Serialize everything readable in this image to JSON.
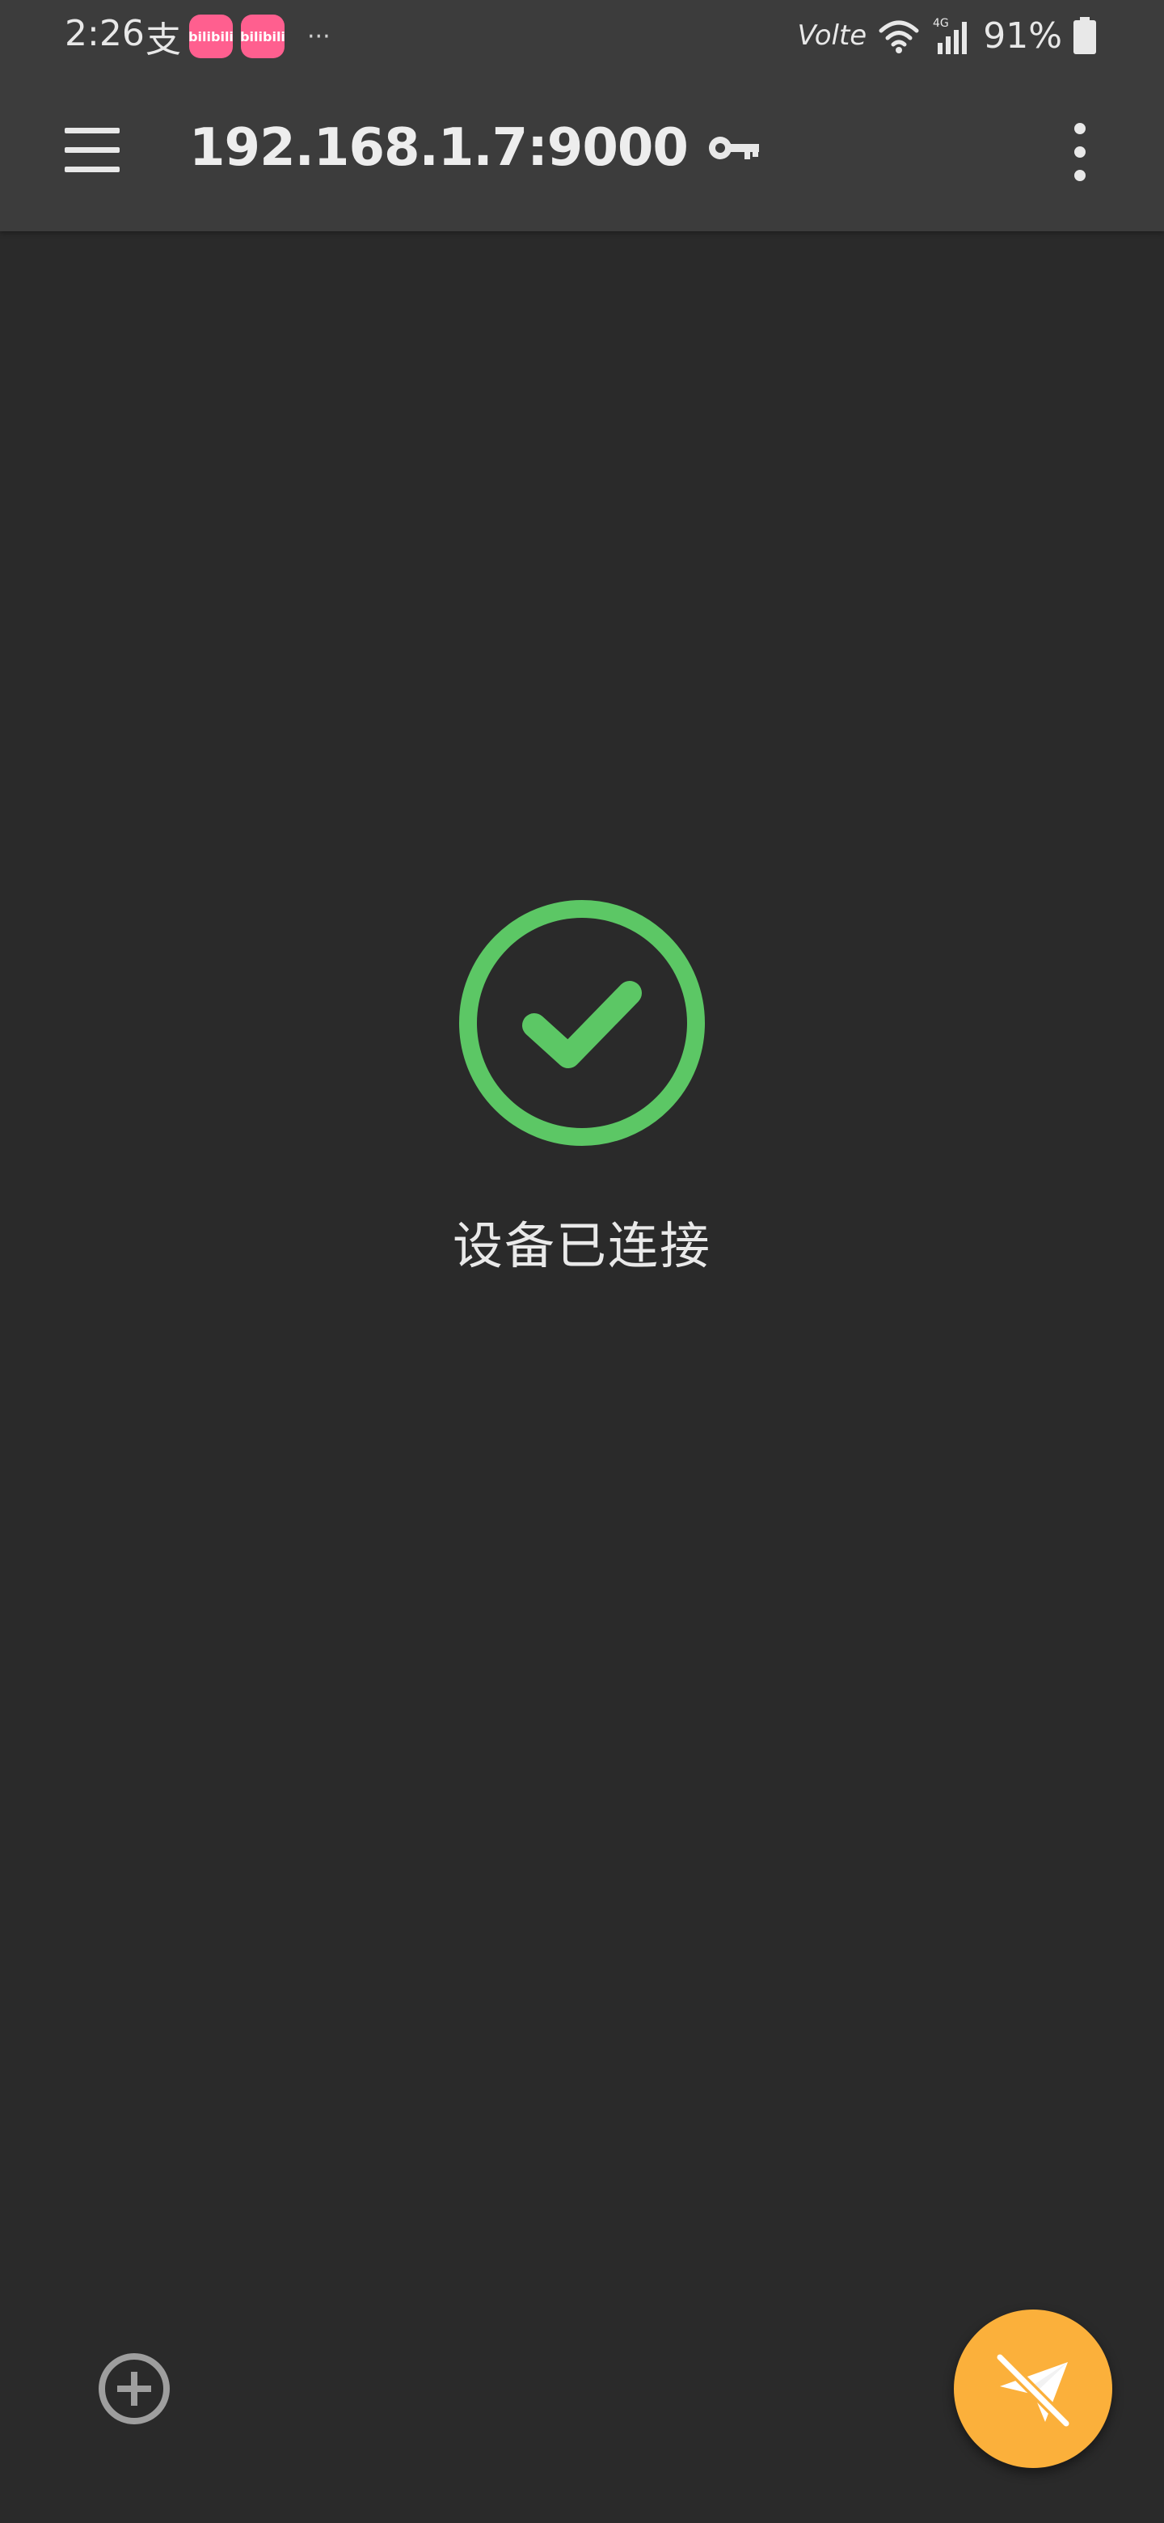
{
  "status_bar": {
    "time": "2:26",
    "alipay_glyph": "支",
    "bili_label": "bilibili",
    "more_notifications": "···",
    "volte_label": "Volte",
    "network_label": "4G",
    "battery_percent": "91%"
  },
  "app_bar": {
    "title": "192.168.1.7:9000",
    "menu_icon": "hamburger-menu-icon",
    "key_icon": "key-icon",
    "overflow_icon": "more-vert-icon"
  },
  "main": {
    "status_text": "设备已连接",
    "status_icon": "check-circle-icon",
    "status_color": "#5cc765"
  },
  "bottom": {
    "add_icon": "add-circle-icon",
    "fab_icon": "send-off-icon",
    "fab_color": "#fbb03b"
  }
}
